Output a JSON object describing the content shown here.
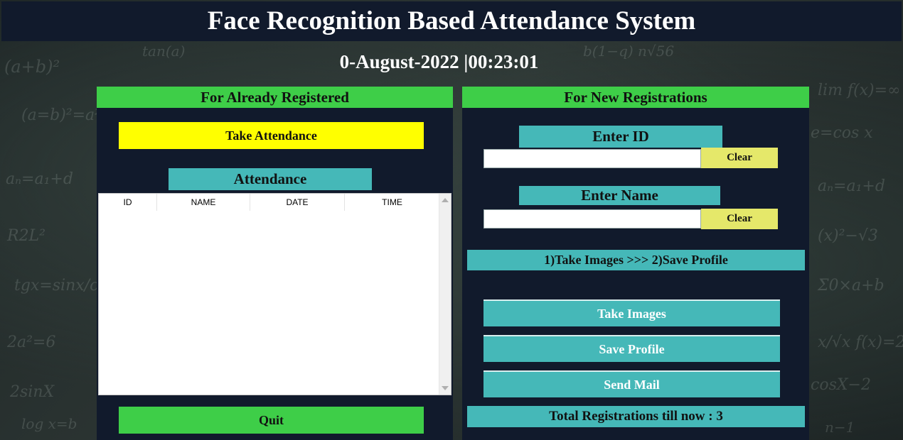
{
  "app": {
    "title": "Face Recognition Based Attendance System",
    "datetime": "0-August-2022  |00:23:01"
  },
  "left_panel": {
    "header": "For Already Registered",
    "take_attendance_label": "Take Attendance",
    "attendance_label": "Attendance",
    "table": {
      "columns": [
        "ID",
        "NAME",
        "DATE",
        "TIME"
      ],
      "rows": []
    },
    "quit_label": "Quit"
  },
  "right_panel": {
    "header": "For New Registrations",
    "enter_id_label": "Enter ID",
    "id_value": "",
    "clear_id_label": "Clear",
    "enter_name_label": "Enter Name",
    "name_value": "",
    "clear_name_label": "Clear",
    "instructions": "1)Take Images  >>>  2)Save Profile",
    "take_images_label": "Take Images",
    "save_profile_label": "Save Profile",
    "send_mail_label": "Send Mail",
    "total_registrations": "Total Registrations till now  : 3"
  },
  "colors": {
    "panel_bg": "#111a2c",
    "header_green": "#3ece48",
    "take_attendance_yellow": "#ffff00",
    "teal": "#45b8b8",
    "clear_yellow": "#e5e86a"
  }
}
